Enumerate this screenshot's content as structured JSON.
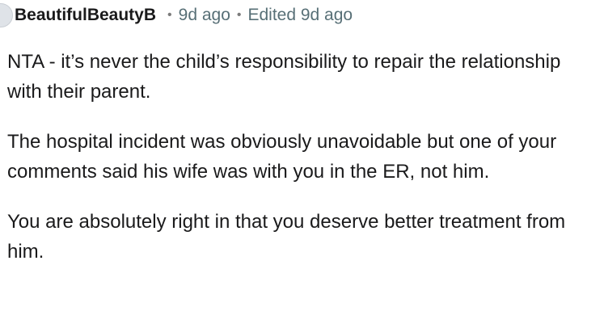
{
  "comment": {
    "author": "BeautifulBeautyB",
    "separator": "•",
    "posted": "9d ago",
    "edited": "Edited 9d ago",
    "paragraphs": [
      "NTA - it’s never the child’s responsibility to repair the relationship with their parent.",
      "The hospital incident was obviously unavoidable but one of your comments said his wife was with you in the ER, not him.",
      "You are absolutely right in that you deserve better treatment from him."
    ]
  }
}
